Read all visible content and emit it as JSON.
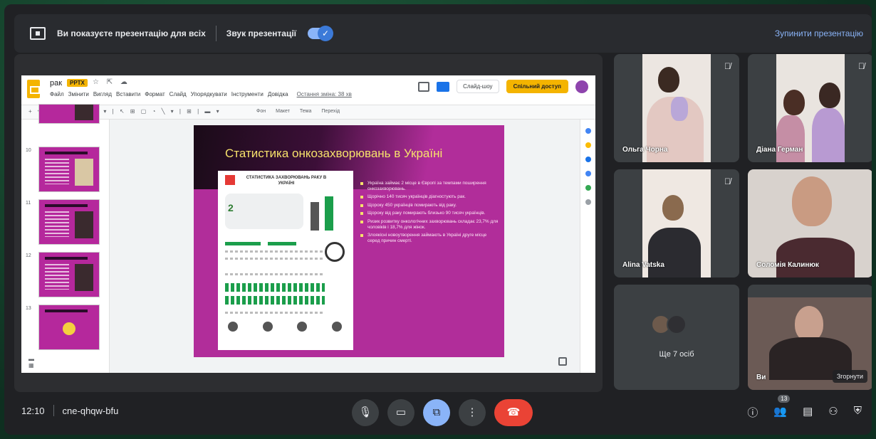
{
  "banner": {
    "presenting_text": "Ви показуєте презентацію для всіх",
    "sound_label": "Звук презентації",
    "toggle_state": "on",
    "stop_label": "Зупинити презентацію"
  },
  "slides_app": {
    "doc_title": "рак",
    "file_badge": "PPTX",
    "menu": [
      "Файл",
      "Змінити",
      "Вигляд",
      "Вставити",
      "Формат",
      "Слайд",
      "Упорядкувати",
      "Інструменти",
      "Довідка"
    ],
    "last_edit": "Остання зміна: 38 хв",
    "slideshow_label": "Слайд-шоу",
    "share_label": "Спільний доступ",
    "toolbar_labels": [
      "Фон",
      "Макет",
      "Тема",
      "Перехід"
    ],
    "thumb_numbers": [
      "10",
      "11",
      "12",
      "13"
    ]
  },
  "slide": {
    "title": "Статистика онкозахворювань в Україні",
    "infographic_title": "СТАТИСТИКА ЗАХВОРЮВАНЬ РАКУ В УКРАЇНІ",
    "infographic_big": "2",
    "bullets": [
      "Україна займає 2 місце в Європі за темпами поширення онкозахворювань.",
      "Щорічно 140 тисяч українців діагностують рак.",
      "Щороку 450 українців помирають від раку.",
      "Щороку від раку помирають близько 90 тисяч українців.",
      "Ризик розвитку онкологічних захворювань складає 23,7% для чоловіків і 18,7% для жінок.",
      "Злоякісні новоутворення займають в Україні друге місце серед причин смерті."
    ]
  },
  "participants": [
    {
      "name": "Ольга Чорна",
      "muted": true
    },
    {
      "name": "Діана Герман",
      "muted": true
    },
    {
      "name": "Alina Vatska",
      "muted": true
    },
    {
      "name": "Соломія Калинюк",
      "muted": false
    },
    {
      "name": "Ще 7 осіб"
    },
    {
      "name": "Ви"
    }
  ],
  "self_tile": {
    "collapse_label": "Згорнути"
  },
  "bottom": {
    "time": "12:10",
    "meeting_code": "cne-qhqw-bfu",
    "participant_count": "13"
  },
  "colors": {
    "accent": "#8ab4f8",
    "hangup": "#ea4335",
    "slide_bg": "#b12d9a",
    "slide_title": "#f6e16b",
    "share_button": "#f4b400"
  }
}
